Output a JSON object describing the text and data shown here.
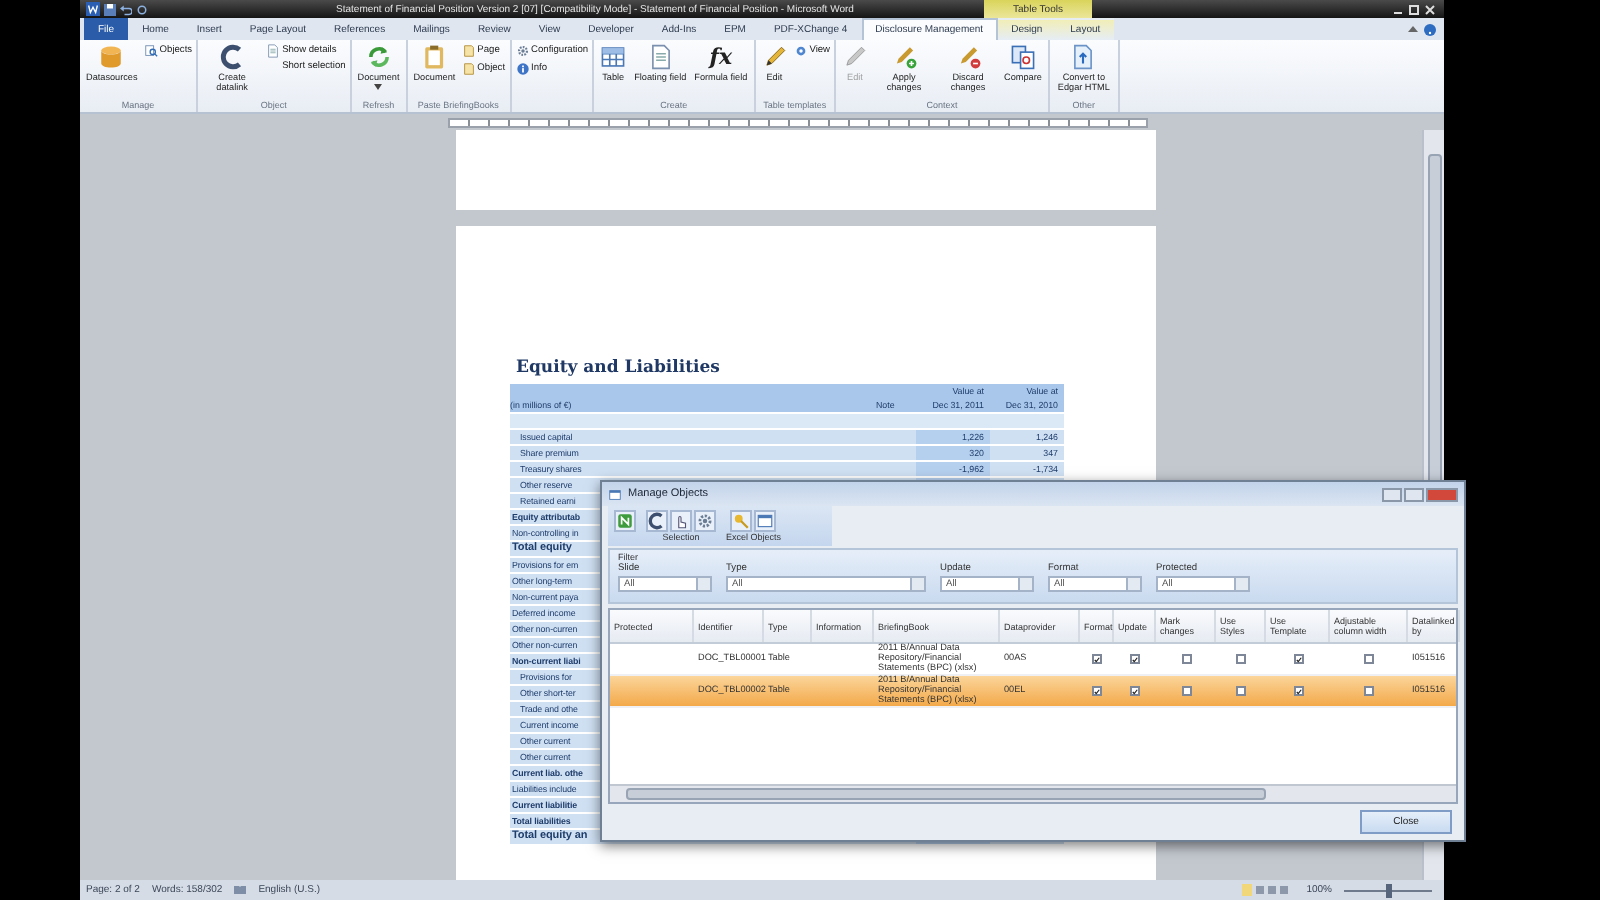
{
  "window": {
    "title": "Statement of Financial Position Version 2 [07] [Compatibility Mode] - Statement of Financial Position - Microsoft Word"
  },
  "contextual_tab_group": {
    "label": "Table Tools"
  },
  "tabs": [
    {
      "label": "File",
      "selected": false,
      "kind": "file"
    },
    {
      "label": "Home",
      "selected": false,
      "kind": "normal"
    },
    {
      "label": "Insert",
      "selected": false,
      "kind": "normal"
    },
    {
      "label": "Page Layout",
      "selected": false,
      "kind": "normal"
    },
    {
      "label": "References",
      "selected": false,
      "kind": "normal"
    },
    {
      "label": "Mailings",
      "selected": false,
      "kind": "normal"
    },
    {
      "label": "Review",
      "selected": false,
      "kind": "normal"
    },
    {
      "label": "View",
      "selected": false,
      "kind": "normal"
    },
    {
      "label": "Developer",
      "selected": false,
      "kind": "normal"
    },
    {
      "label": "Add-Ins",
      "selected": false,
      "kind": "normal"
    },
    {
      "label": "EPM",
      "selected": false,
      "kind": "normal"
    },
    {
      "label": "PDF-XChange 4",
      "selected": false,
      "kind": "normal"
    },
    {
      "label": "Disclosure Management",
      "selected": true,
      "kind": "normal"
    },
    {
      "label": "Design",
      "selected": false,
      "kind": "contextual"
    },
    {
      "label": "Layout",
      "selected": false,
      "kind": "contextual"
    }
  ],
  "ribbon": {
    "groups": [
      {
        "label": "Manage",
        "buttons": [
          {
            "label": "Datasources",
            "kind": "large",
            "disabled": false
          },
          {
            "label": "Objects",
            "kind": "small",
            "disabled": false
          }
        ]
      },
      {
        "label": "Object",
        "buttons": [
          {
            "label": "Create datalink",
            "kind": "large",
            "disabled": false
          },
          {
            "label": "Show details",
            "kind": "small",
            "disabled": false
          },
          {
            "label": "Short selection",
            "kind": "small",
            "disabled": false
          }
        ]
      },
      {
        "label": "Refresh",
        "buttons": [
          {
            "label": "Document",
            "kind": "large-menu",
            "disabled": false
          }
        ]
      },
      {
        "label": "Paste BriefingBooks",
        "buttons": [
          {
            "label": "Document",
            "kind": "large",
            "disabled": false
          },
          {
            "label": "Page",
            "kind": "small",
            "disabled": false
          },
          {
            "label": "Object",
            "kind": "small",
            "disabled": false
          }
        ]
      },
      {
        "buttons": [
          {
            "label": "Configuration",
            "kind": "small",
            "disabled": false
          },
          {
            "label": "Info",
            "kind": "small",
            "disabled": false
          }
        ]
      },
      {
        "label": "Create",
        "buttons": [
          {
            "label": "Table",
            "kind": "large",
            "disabled": false
          },
          {
            "label": "Floating field",
            "kind": "large",
            "disabled": false
          },
          {
            "label": "Formula field",
            "kind": "large",
            "disabled": false,
            "glyph": "fx"
          }
        ]
      },
      {
        "label": "Table templates",
        "buttons": [
          {
            "label": "Edit",
            "kind": "large",
            "disabled": false
          },
          {
            "label": "View",
            "kind": "small",
            "disabled": false
          }
        ]
      },
      {
        "label": "Context",
        "buttons": [
          {
            "label": "Edit",
            "kind": "large",
            "disabled": true
          },
          {
            "label": "Apply changes",
            "kind": "large",
            "disabled": false
          },
          {
            "label": "Discard changes",
            "kind": "large",
            "disabled": false
          },
          {
            "label": "Compare",
            "kind": "large",
            "disabled": false
          }
        ]
      },
      {
        "label": "Other",
        "buttons": [
          {
            "label": "Convert to Edgar HTML",
            "kind": "large",
            "disabled": false
          }
        ]
      }
    ]
  },
  "document": {
    "heading": "Equity and Liabilities",
    "table": {
      "unit": "(in millions of €)",
      "note_header": "Note",
      "value_columns": [
        {
          "top": "Value at",
          "bottom": "Dec 31, 2011"
        },
        {
          "top": "Value at",
          "bottom": "Dec 31, 2010"
        }
      ],
      "rows": [
        {
          "label": "Issued capital",
          "kind": "item",
          "values": [
            "1,226",
            "1,246"
          ]
        },
        {
          "label": "Share premium",
          "kind": "item",
          "values": [
            "320",
            "347"
          ]
        },
        {
          "label": "Treasury shares",
          "kind": "item",
          "values": [
            "-1,962",
            "-1,734"
          ]
        },
        {
          "label": "Other reserve",
          "kind": "item"
        },
        {
          "label": "Retained earni",
          "kind": "item"
        },
        {
          "label": "Equity attributab",
          "kind": "subtotal"
        },
        {
          "label": "Non-controlling in",
          "kind": "plain"
        },
        {
          "label": "Total equity",
          "kind": "total"
        },
        {
          "label": "Provisions for em",
          "kind": "plain"
        },
        {
          "label": "Other long-term",
          "kind": "plain"
        },
        {
          "label": "Non-current paya",
          "kind": "plain"
        },
        {
          "label": "Deferred income",
          "kind": "plain"
        },
        {
          "label": "Other non-curren",
          "kind": "plain"
        },
        {
          "label": "Other non-curren",
          "kind": "plain"
        },
        {
          "label": "Non-current liabi",
          "kind": "subtotal"
        },
        {
          "label": "Provisions for",
          "kind": "item"
        },
        {
          "label": "Other short-ter",
          "kind": "item"
        },
        {
          "label": "Trade and othe",
          "kind": "item"
        },
        {
          "label": "Current income",
          "kind": "item"
        },
        {
          "label": "Other current",
          "kind": "item"
        },
        {
          "label": "Other current",
          "kind": "item"
        },
        {
          "label": "Current liab. othe",
          "kind": "subtotal"
        },
        {
          "label": "Liabilities include",
          "kind": "plain"
        },
        {
          "label": "Current liabilitie",
          "kind": "subtotal"
        },
        {
          "label": "Total liabilities",
          "kind": "subtotal"
        },
        {
          "label": "Total equity an",
          "kind": "total"
        }
      ]
    }
  },
  "dialog": {
    "title": "Manage Objects",
    "toolbar_labels": [
      "Selection",
      "Excel Objects"
    ],
    "filter": {
      "label": "Filter",
      "fields": [
        {
          "label": "Slide",
          "value": "All"
        },
        {
          "label": "Type",
          "value": "All"
        },
        {
          "label": "Update",
          "value": "All"
        },
        {
          "label": "Format",
          "value": "All"
        },
        {
          "label": "Protected",
          "value": "All"
        }
      ]
    },
    "table": {
      "columns": [
        "Protected",
        "Identifier",
        "Type",
        "Information",
        "BriefingBook",
        "Dataprovider",
        "Format",
        "Update",
        "Mark changes",
        "Use Styles",
        "Use Template",
        "Adjustable column width",
        "Datalinked by"
      ],
      "rows": [
        {
          "identifier": "DOC_TBL00001",
          "type": "Table",
          "briefing_book": "2011 B/Annual Data Repository/Financial Statements (BPC) (xlsx)",
          "dataprovider": "00AS",
          "format": true,
          "update": true,
          "mark_changes": false,
          "use_styles": false,
          "use_template": true,
          "adjustable_column_width": false,
          "datalinked_by": "I051516",
          "selected": false
        },
        {
          "identifier": "DOC_TBL00002",
          "type": "Table",
          "briefing_book": "2011 B/Annual Data Repository/Financial Statements (BPC) (xlsx)",
          "dataprovider": "00EL",
          "format": true,
          "update": true,
          "mark_changes": false,
          "use_styles": false,
          "use_template": true,
          "adjustable_column_width": false,
          "datalinked_by": "I051516",
          "selected": true
        }
      ]
    },
    "close_button": "Close"
  },
  "status_bar": {
    "page": "Page: 2 of 2",
    "words": "Words: 158/302",
    "language": "English (U.S.)",
    "zoom": {
      "label": "100%",
      "level": 0.5
    }
  }
}
